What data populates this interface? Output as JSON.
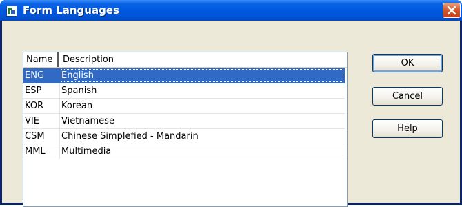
{
  "window": {
    "title": "Form Languages"
  },
  "icons": {
    "app": "form-app-icon",
    "close": "close-icon"
  },
  "colors": {
    "title_bar": "#0054d8",
    "selection": "#316ac5",
    "close_button": "#d9582c",
    "face": "#ece9d8"
  },
  "list": {
    "columns": [
      "Name",
      "Description"
    ],
    "rows": [
      {
        "code": "ENG",
        "description": "English",
        "selected": true
      },
      {
        "code": "ESP",
        "description": "Spanish",
        "selected": false
      },
      {
        "code": "KOR",
        "description": "Korean",
        "selected": false
      },
      {
        "code": "VIE",
        "description": "Vietnamese",
        "selected": false
      },
      {
        "code": "CSM",
        "description": "Chinese Simplefied - Mandarin",
        "selected": false
      },
      {
        "code": "MML",
        "description": "Multimedia",
        "selected": false
      }
    ]
  },
  "buttons": {
    "ok": "OK",
    "cancel": "Cancel",
    "help": "Help"
  }
}
